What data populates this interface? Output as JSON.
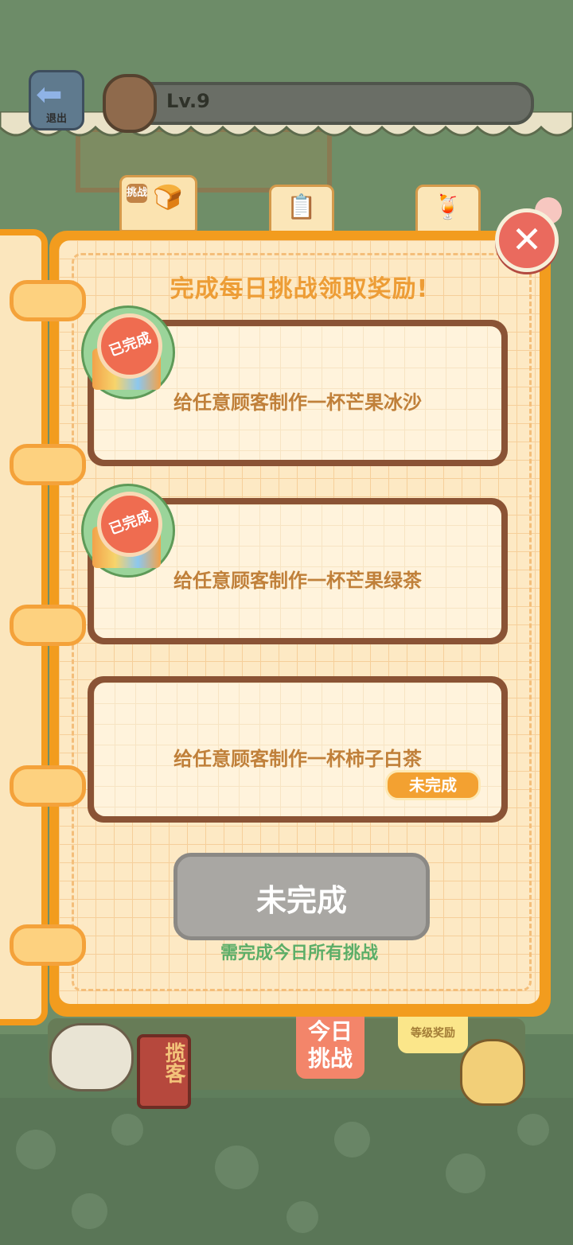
{
  "top_bar": {
    "exit_label": "退出",
    "level": "Lv.9"
  },
  "tabs": [
    {
      "label": "挑战",
      "icon": "bread-icon",
      "active": true
    },
    {
      "label": "",
      "icon": "clipboard-icon",
      "active": false
    },
    {
      "label": "",
      "icon": "drink-icon",
      "active": false
    }
  ],
  "panel": {
    "title": "完成每日挑战领取奖励!",
    "challenges": [
      {
        "text": "给任意顾客制作一杯芒果冰沙",
        "status": "已完成"
      },
      {
        "text": "给任意顾客制作一杯芒果绿茶",
        "status": "已完成"
      },
      {
        "text": "给任意顾客制作一杯柿子白茶",
        "status": "未完成"
      }
    ],
    "claim_button": "未完成",
    "hint": "需完成今日所有挑战"
  },
  "bottom_tabs": {
    "today": "今日挑战",
    "today_line1": "今日",
    "today_line2": "挑战",
    "level_reward": "等级奖励"
  },
  "scene": {
    "sign": "揽客"
  },
  "colors": {
    "book_border": "#f29c1e",
    "title": "#ed9d36",
    "done_seal": "#ef6c50",
    "pending_pill": "#f3a131",
    "hint": "#5cae68",
    "disabled_button": "#a9a7a3"
  }
}
